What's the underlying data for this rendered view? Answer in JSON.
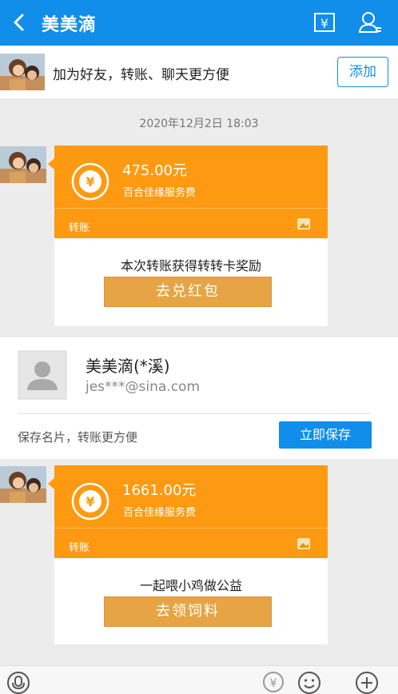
{
  "header": {
    "title": "美美滴"
  },
  "add_friend": {
    "text": "加为好友，转账、聊天更方便",
    "button": "添加"
  },
  "timestamp": "2020年12月2日 18:03",
  "messages": [
    {
      "amount": "475.00元",
      "desc": "百合佳缘服务费",
      "kind": "转账",
      "promo": "本次转账获得转转卡奖励",
      "button": "去兑红包"
    },
    {
      "amount": "1661.00元",
      "desc": "百合佳缘服务费",
      "kind": "转账",
      "promo": "一起喂小鸡做公益",
      "button": "去领饲料"
    }
  ],
  "contact_card": {
    "name": "美美滴(*溪)",
    "email": "jes***@sina.com",
    "hint": "保存名片，转账更方便",
    "button": "立即保存"
  },
  "icons": {
    "back": "chevron-left-icon",
    "bill": "yen-bill-icon",
    "profile": "person-icon",
    "voice": "microphone-icon",
    "transfer": "yen-circle-icon",
    "emoji": "smiley-icon",
    "more": "plus-circle-icon"
  },
  "colors": {
    "header": "#108ee9",
    "transfer_card": "#fd9a11",
    "promo_button": "#e6a445"
  }
}
